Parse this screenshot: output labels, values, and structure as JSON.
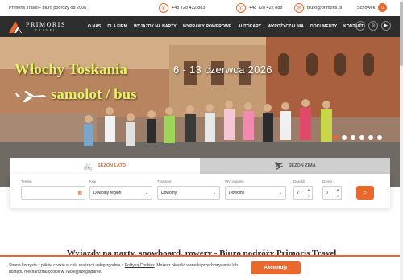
{
  "topbar": {
    "tagline": "Primoris Travel - biuro podróży od 2006",
    "phone1": "+48 728 422 883",
    "phone2": "+48 728 422 888",
    "email": "biuro@primoris.pl",
    "schowek_label": "Schowek",
    "schowek_count": "0"
  },
  "logo": {
    "line1": "PRIMORIS",
    "line2": "TRAVEL"
  },
  "menu": [
    "O NAS",
    "DLA FIRM",
    "WYJAZDY NA NARTY",
    "WYPRAWY ROWEROWE",
    "AUTOKARY",
    "WYPOŻYCZALNIA",
    "DOKUMENTY",
    "KONTAKT"
  ],
  "socials": {
    "facebook": "f",
    "instagram": "◎",
    "youtube": "▶"
  },
  "hero": {
    "title_line1": "Włochy Toskania",
    "title_line2": "samolot / bus",
    "dates": "6 - 13 czerwca 2026",
    "slide_count": 6,
    "active_slide": 1
  },
  "seasons": {
    "summer": "SEZON LATO",
    "winter": "SEZON ZIMA"
  },
  "search": {
    "termin_label": "Termin",
    "termin_value": "",
    "kraj_label": "Kraj",
    "kraj_value": "Dowolny region",
    "transport_label": "Transport",
    "transport_value": "Dowolny",
    "wyzywienie_label": "Wyżywienie",
    "wyzywienie_value": "Dowolne",
    "dorosli_label": "Dorośli",
    "dorosli_value": "2",
    "dzieci_label": "Dzieci",
    "dzieci_value": "0"
  },
  "headline": "Wyjazdy na narty, snowboard, rowery - Biuro podróży Primoris Travel",
  "cookie": {
    "text_before": "Strona korzysta z plików cookie w celu realizacji usług zgodnie z ",
    "link": "Polityką Cookies",
    "text_after": ". Możesz określić warunki przechowywania lub dostępu mechanizmu cookie w Twojej przeglądarce.",
    "accept_label": "Akceptuję"
  },
  "colors": {
    "accent": "#e9692c",
    "nav_bg": "#2d2d2d",
    "hero_title": "#e8f064"
  }
}
